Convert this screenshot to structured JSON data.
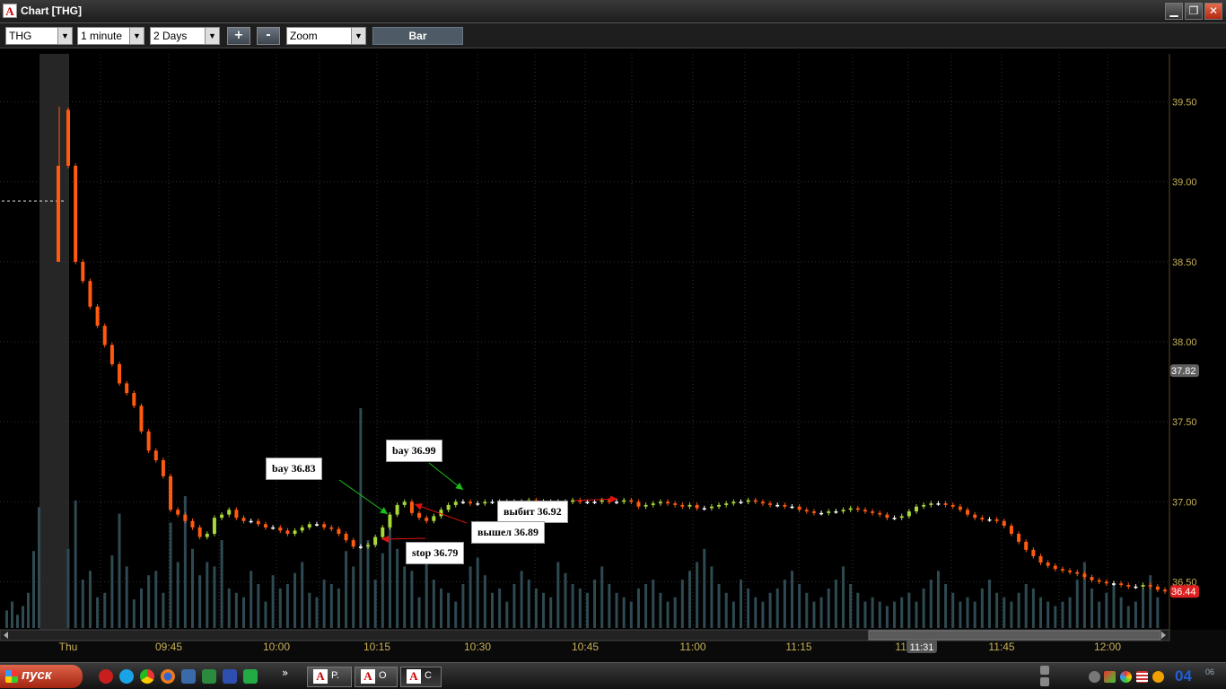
{
  "window": {
    "icon": "A",
    "title": "Chart [THG]",
    "buttons": [
      "minimize-icon",
      "restore-icon",
      "close-icon"
    ],
    "minimize_glyph": "▁",
    "restore_glyph": "❐",
    "close_glyph": "✕"
  },
  "toolbar": {
    "symbol": "THG",
    "interval": "1 minute",
    "range": "2 Days",
    "zoom_in_label": "+",
    "zoom_out_label": "-",
    "zoom_mode": "Zoom",
    "chart_type_label": "Bar",
    "dropdown_arrow": "▼"
  },
  "chart_data": {
    "type": "candlestick",
    "price_axis": {
      "ticks": [
        "39.50",
        "39.00",
        "38.50",
        "38.00",
        "37.50",
        "37.00",
        "36.50"
      ],
      "min": 36.2,
      "max": 39.8
    },
    "time_axis": {
      "ticks": [
        "Thu",
        "09:45",
        "10:00",
        "10:15",
        "10:30",
        "10:45",
        "11:00",
        "11:15",
        "11:30",
        "11:45",
        "12:00"
      ]
    },
    "crosshair_time": "11:31",
    "price_markers": [
      {
        "value": 37.82,
        "label": "37.82",
        "color": "#606060"
      },
      {
        "value": 36.44,
        "label": "36.44",
        "color": "#e02020"
      }
    ],
    "colors": {
      "up": "#a8d838",
      "down": "#ff5a10",
      "flat": "#ffffff",
      "grid": "#303030",
      "axis_text": "#c8b058",
      "volume": "#2f4a52",
      "highlight": "#262626"
    },
    "prev_day_close": 38.88,
    "intraday_closes": [
      39.1,
      38.5,
      38.38,
      38.22,
      38.1,
      37.98,
      37.86,
      37.74,
      37.68,
      37.6,
      37.44,
      37.32,
      37.26,
      37.16,
      36.95,
      36.92,
      36.88,
      36.84,
      36.78,
      36.8,
      36.9,
      36.92,
      36.95,
      36.9,
      36.88,
      36.88,
      36.86,
      36.84,
      36.84,
      36.82,
      36.8,
      36.82,
      36.84,
      36.86,
      36.86,
      36.84,
      36.83,
      36.8,
      36.76,
      36.72,
      36.72,
      36.73,
      36.78,
      36.84,
      36.92,
      36.98,
      37.0,
      36.93,
      36.9,
      36.88,
      36.91,
      36.95,
      36.98,
      37.0,
      37.0,
      36.99,
      36.99,
      37.0,
      37.0,
      37.0,
      37.0,
      37.0,
      37.0,
      37.01,
      37.0,
      37.0,
      37.0,
      37.0,
      37.0,
      37.01,
      37.0,
      37.0,
      37.0,
      37.01,
      37.0,
      37.0,
      37.01,
      37.0,
      36.97,
      36.98,
      36.99,
      37.0,
      36.99,
      36.98,
      36.97,
      36.98,
      36.96,
      36.96,
      36.97,
      36.98,
      36.99,
      37.0,
      37.0,
      37.01,
      37.0,
      36.99,
      36.98,
      36.98,
      36.97,
      36.97,
      36.95,
      36.94,
      36.93,
      36.93,
      36.94,
      36.94,
      36.95,
      36.96,
      36.95,
      36.94,
      36.93,
      36.92,
      36.9,
      36.9,
      36.91,
      36.94,
      36.97,
      36.98,
      36.99,
      36.99,
      36.98,
      36.97,
      36.95,
      36.92,
      36.9,
      36.89,
      36.89,
      36.88,
      36.85,
      36.8,
      36.75,
      36.7,
      36.66,
      36.62,
      36.6,
      36.58,
      36.57,
      36.56,
      36.55,
      36.53,
      36.51,
      36.5,
      36.49,
      36.49,
      36.48,
      36.47,
      36.47,
      36.48,
      36.47,
      36.45,
      36.44
    ],
    "intraday_volume": [
      0.36,
      0.58,
      0.22,
      0.26,
      0.14,
      0.16,
      0.33,
      0.52,
      0.28,
      0.13,
      0.18,
      0.24,
      0.26,
      0.16,
      0.48,
      0.3,
      0.6,
      0.36,
      0.24,
      0.3,
      0.28,
      0.4,
      0.18,
      0.16,
      0.14,
      0.26,
      0.2,
      0.12,
      0.24,
      0.18,
      0.2,
      0.25,
      0.3,
      0.16,
      0.14,
      0.22,
      0.2,
      0.18,
      0.35,
      0.28,
      1.0,
      0.4,
      0.22,
      0.34,
      0.48,
      0.36,
      0.28,
      0.26,
      0.14,
      0.3,
      0.22,
      0.18,
      0.16,
      0.12,
      0.2,
      0.28,
      0.32,
      0.24,
      0.16,
      0.18,
      0.12,
      0.2,
      0.26,
      0.22,
      0.18,
      0.16,
      0.14,
      0.3,
      0.25,
      0.2,
      0.18,
      0.16,
      0.22,
      0.28,
      0.2,
      0.16,
      0.14,
      0.12,
      0.18,
      0.2,
      0.22,
      0.16,
      0.12,
      0.14,
      0.22,
      0.26,
      0.3,
      0.36,
      0.28,
      0.2,
      0.16,
      0.12,
      0.22,
      0.18,
      0.14,
      0.12,
      0.16,
      0.18,
      0.22,
      0.26,
      0.2,
      0.16,
      0.12,
      0.14,
      0.18,
      0.22,
      0.28,
      0.2,
      0.16,
      0.12,
      0.14,
      0.12,
      0.1,
      0.12,
      0.14,
      0.16,
      0.12,
      0.18,
      0.22,
      0.26,
      0.2,
      0.16,
      0.12,
      0.14,
      0.12,
      0.18,
      0.22,
      0.16,
      0.14,
      0.12,
      0.16,
      0.2,
      0.18,
      0.14,
      0.12,
      0.1,
      0.12,
      0.14,
      0.22,
      0.3,
      0.18,
      0.12,
      0.16,
      0.2,
      0.14,
      0.1,
      0.12,
      0.18,
      0.24,
      0.14
    ],
    "annotations": [
      {
        "text": "bay 36.83",
        "price": 36.83,
        "color": "#18c018"
      },
      {
        "text": "stop 36.79",
        "price": 36.79,
        "color": "#e01010"
      },
      {
        "text": "bay 36.99",
        "price": 36.99,
        "color": "#18c018"
      },
      {
        "text": "выбит 36.92",
        "price": 36.92,
        "color": "#e01010"
      },
      {
        "text": "вышел 36.89",
        "price": 36.89,
        "color": "#e01010"
      }
    ]
  },
  "taskbar": {
    "start_label": "пуск",
    "quicklaunch": [
      "opera-icon",
      "skype-icon",
      "chrome-icon",
      "firefox-icon",
      "desktop-icon",
      "excel-icon",
      "save-icon",
      "terminal-icon"
    ],
    "chevron": "»",
    "tasks": [
      {
        "label": "P.",
        "active": false
      },
      {
        "label": "O",
        "active": false
      },
      {
        "label": "C",
        "active": true
      }
    ],
    "tray": [
      "nav-left-icon",
      "network-icon",
      "color-icon",
      "flag-icon",
      "speaker-icon"
    ],
    "clock": "04",
    "clock_sub": "06"
  }
}
